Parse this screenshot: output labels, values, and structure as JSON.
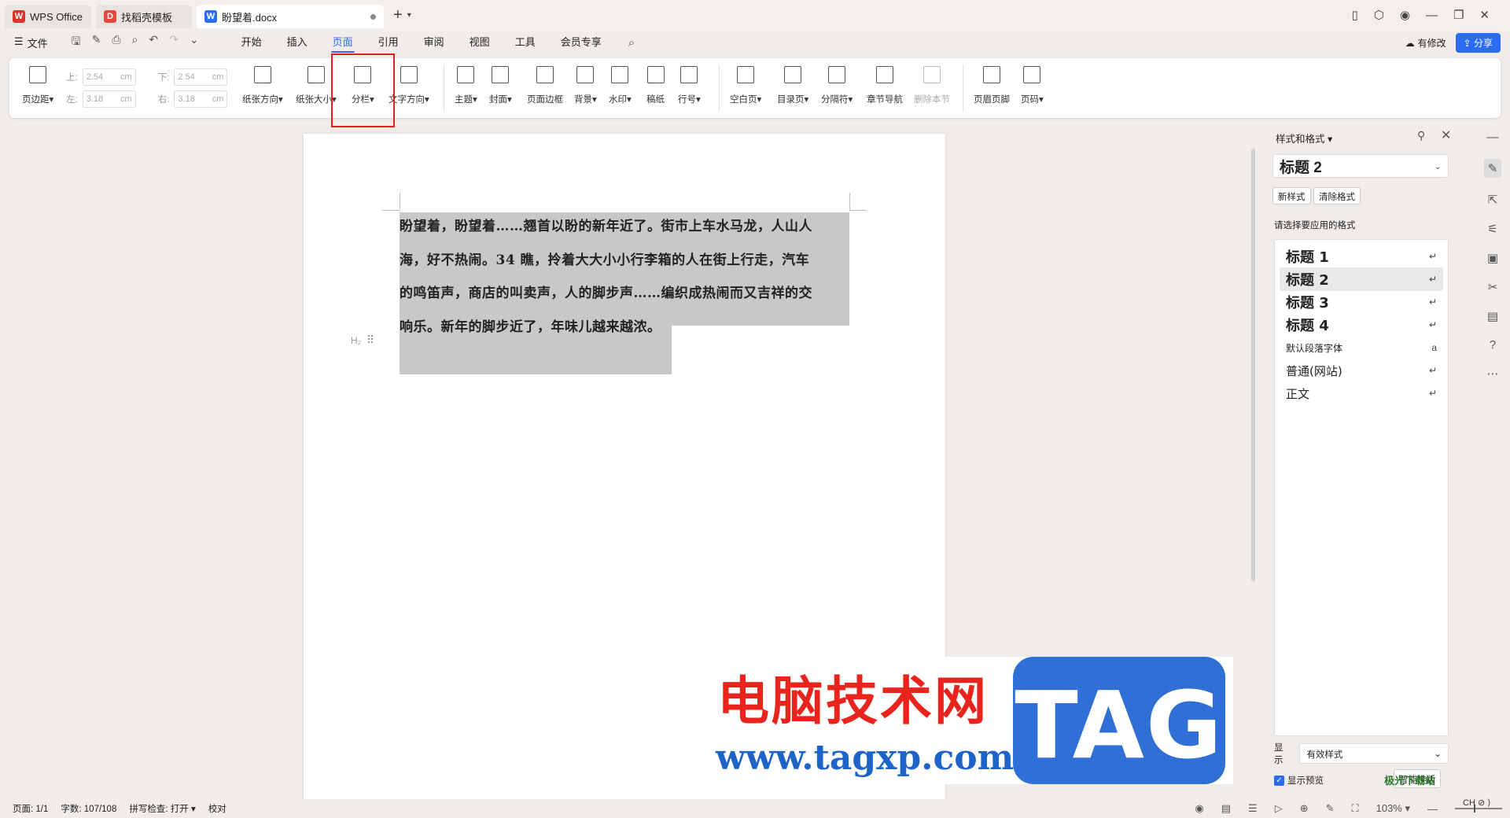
{
  "titlebar": {
    "tabs": [
      {
        "label": "WPS Office",
        "logo": "W",
        "color": "#d9342b"
      },
      {
        "label": "找稻壳模板",
        "logo": "D",
        "color": "#e4493c"
      },
      {
        "label": "盼望着.docx",
        "logo": "W",
        "color": "#2b6cf0"
      }
    ],
    "add_tab": "+",
    "more": "⌄"
  },
  "menubar": {
    "file_label": "文件",
    "tabs": [
      "开始",
      "插入",
      "页面",
      "引用",
      "审阅",
      "视图",
      "工具",
      "会员专享"
    ],
    "active_tab": "页面",
    "modified_label": "有修改",
    "share_label": "分享"
  },
  "ribbon": {
    "margin_label": "页边距",
    "margins": {
      "top_label": "上:",
      "top_value": "2.54",
      "top_unit": "cm",
      "bottom_label": "下:",
      "bottom_value": "2.54",
      "bottom_unit": "cm",
      "left_label": "左:",
      "left_value": "3.18",
      "left_unit": "cm",
      "right_label": "右:",
      "right_value": "3.18",
      "right_unit": "cm"
    },
    "buttons": [
      "纸张方向",
      "纸张大小",
      "分栏",
      "文字方向",
      "主题",
      "封面",
      "页面边框",
      "背景",
      "水印",
      "稿纸",
      "行号",
      "空白页",
      "目录页",
      "分隔符",
      "章节导航",
      "删除本节",
      "页眉页脚",
      "页码"
    ]
  },
  "document": {
    "paragraph": "盼望着，盼望着……翘首以盼的新年近了。街市上车水马龙，人山人海，好不热闹。34 瞧，拎着大大小小行李箱的人在街上行走，汽车的鸣笛声，商店的叫卖声，人的脚步声……编织成热闹而又吉祥的交响乐。新年的脚步近了，年味儿越来越浓。",
    "lines": [
      "盼望着，盼望着……翘首以盼的新年近了。街市上车水马龙，人山人",
      "海，好不热闹。34 瞧，拎着大大小小行李箱的人在街上行走，汽车",
      "的鸣笛声，商店的叫卖声，人的脚步声……编织成热闹而又吉祥的交",
      "响乐。新年的脚步近了，年味儿越来越浓。"
    ],
    "heading_marker": "H₂",
    "drag_marker": "⠿"
  },
  "style_panel": {
    "title": "样式和格式",
    "current_style": "标题  2",
    "new_style": "新样式",
    "clear_format": "清除格式",
    "choose_label": "请选择要应用的格式",
    "styles": [
      {
        "name": "标题  1",
        "mark": "↵",
        "kind": "heading"
      },
      {
        "name": "标题  2",
        "mark": "↵",
        "kind": "heading"
      },
      {
        "name": "标题  3",
        "mark": "↵",
        "kind": "heading"
      },
      {
        "name": "标题  4",
        "mark": "↵",
        "kind": "heading"
      },
      {
        "name": "默认段落字体",
        "mark": "a",
        "kind": "tiny"
      },
      {
        "name": "普通(网站)",
        "mark": "↵",
        "kind": "plain"
      },
      {
        "name": "正文",
        "mark": "↵",
        "kind": "plain"
      }
    ],
    "selected_style": "标题  2",
    "show_label": "显示",
    "show_value": "有效样式",
    "preview_label": "显示预览",
    "preview_checked": true,
    "smart_label": "智能排版"
  },
  "statusbar": {
    "page": "页面: 1/1",
    "words": "字数: 107/108",
    "spell": "拼写检查: 打开",
    "proof": "校对",
    "zoom": "103%"
  },
  "watermark": {
    "cn": "电脑技术网",
    "url": "www.tagxp.com",
    "tag": "TAG",
    "corner": "极光下载站",
    "corner2": "CH ⊘ ⟩"
  },
  "colors": {
    "accent": "#2b6cf0",
    "highlight_box": "#e02020",
    "selection": "#c8c8c8"
  }
}
